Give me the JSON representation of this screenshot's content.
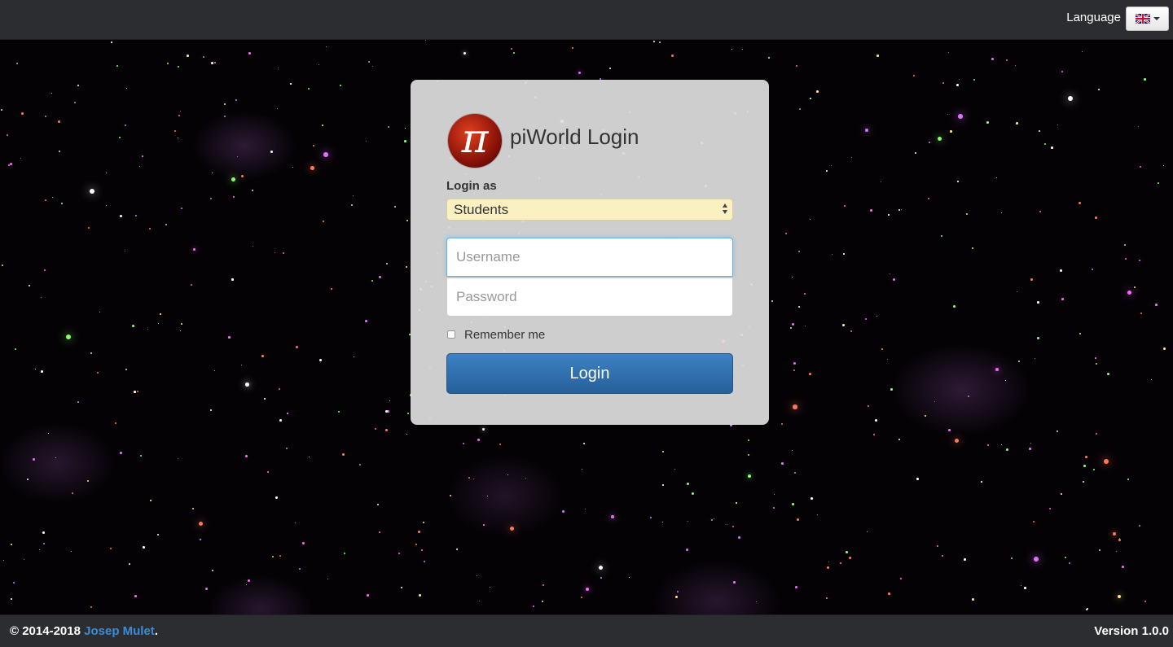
{
  "header": {
    "language_label": "Language",
    "language_flag": "uk-flag-icon"
  },
  "login": {
    "title": "piWorld Login",
    "logo_symbol": "π",
    "login_as_label": "Login as",
    "role_selected": "Students",
    "username_placeholder": "Username",
    "username_value": "",
    "password_placeholder": "Password",
    "password_value": "",
    "remember_label": "Remember me",
    "remember_checked": false,
    "login_button": "Login"
  },
  "footer": {
    "copyright_prefix": "© 2014-2018 ",
    "author": "Josep Mulet",
    "copyright_suffix": ".",
    "version": "Version 1.0.0"
  },
  "colors": {
    "bar_bg": "#2b2d30",
    "select_bg": "#faf0c2",
    "button_blue": "#337ab7",
    "link_blue": "#3a8cd6"
  }
}
